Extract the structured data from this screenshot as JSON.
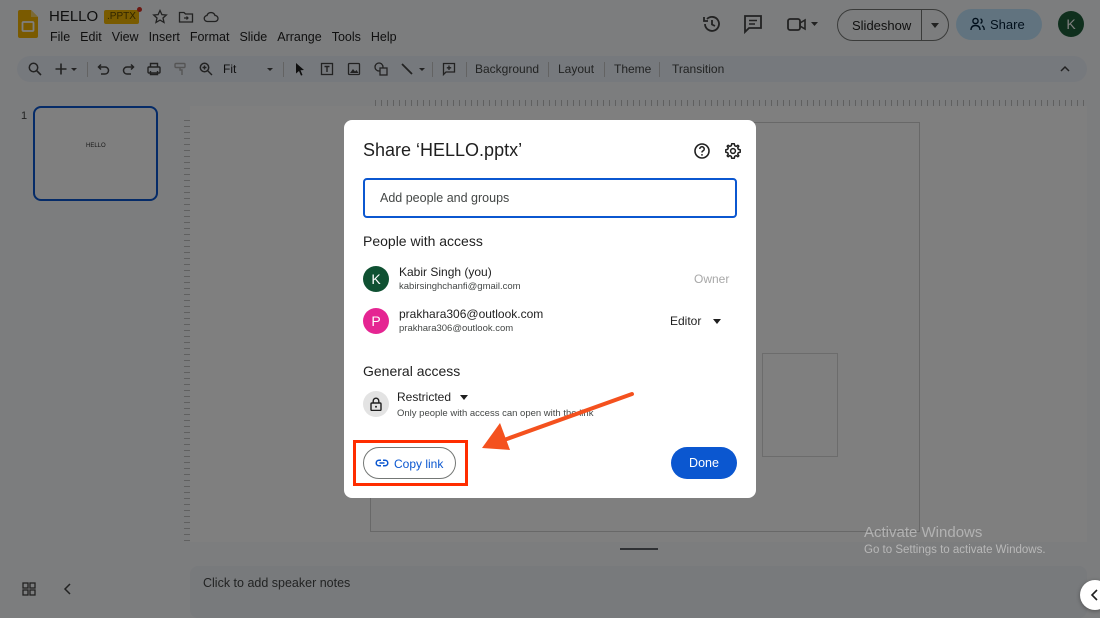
{
  "header": {
    "doc_title": "HELLO",
    "file_badge": ".PPTX",
    "menu": [
      "File",
      "Edit",
      "View",
      "Insert",
      "Format",
      "Slide",
      "Arrange",
      "Tools",
      "Help"
    ],
    "slideshow_label": "Slideshow",
    "share_label": "Share",
    "user_initial": "K"
  },
  "toolbar": {
    "zoom_label": "Fit",
    "background_label": "Background",
    "layout_label": "Layout",
    "theme_label": "Theme",
    "transition_label": "Transition"
  },
  "filmstrip": {
    "slide_number": "1",
    "thumb_text": "HELLO"
  },
  "notes": {
    "placeholder": "Click to add speaker notes"
  },
  "watermark": {
    "title": "Activate Windows",
    "subtitle": "Go to Settings to activate Windows."
  },
  "dialog": {
    "title": "Share ‘HELLO.pptx’",
    "input_placeholder": "Add people and groups",
    "people_heading": "People with access",
    "people": [
      {
        "initial": "K",
        "name": "Kabir Singh (you)",
        "email": "kabirsinghchanfi@gmail.com",
        "role": "Owner",
        "avatar_color": "#0f5132"
      },
      {
        "initial": "P",
        "name": "prakhara306@outlook.com",
        "email": "prakhara306@outlook.com",
        "role": "Editor",
        "avatar_color": "#e52592"
      }
    ],
    "general_heading": "General access",
    "access_level": "Restricted",
    "access_description": "Only people with access can open with the link",
    "copy_link_label": "Copy link",
    "done_label": "Done"
  },
  "colors": {
    "accent": "#0b57d0",
    "share_button": "#c2e7ff",
    "annotation": "#ff2d00"
  }
}
